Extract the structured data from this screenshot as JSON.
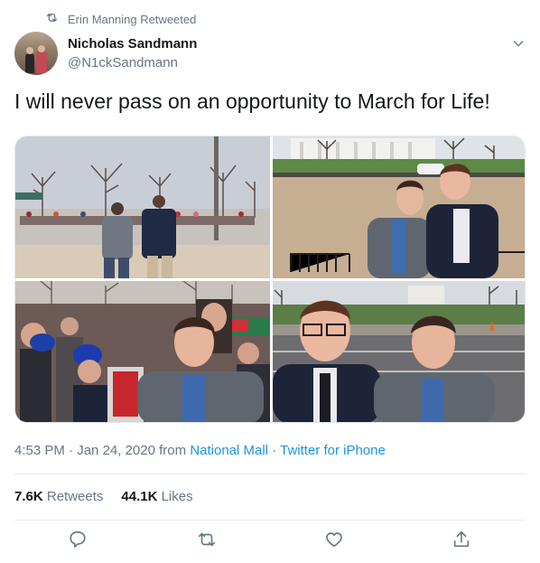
{
  "retweet_context": {
    "text": "Erin Manning Retweeted",
    "icon": "retweet-icon"
  },
  "author": {
    "display_name": "Nicholas Sandmann",
    "handle": "@N1ckSandmann"
  },
  "tweet": {
    "text": "I will never pass on an opportunity to March for Life!"
  },
  "media": {
    "count": 4,
    "photos": [
      {
        "name": "photo-crowd-walking"
      },
      {
        "name": "photo-white-house-two-men"
      },
      {
        "name": "photo-crowd-selfie"
      },
      {
        "name": "photo-mall-two-men"
      }
    ]
  },
  "meta": {
    "time": "4:53 PM",
    "separator": "·",
    "date": "Jan 24, 2020",
    "from_label": "from",
    "location": "National Mall",
    "source": "Twitter for iPhone"
  },
  "stats": {
    "retweets_count": "7.6K",
    "retweets_label": "Retweets",
    "likes_count": "44.1K",
    "likes_label": "Likes"
  },
  "actions": [
    "reply-icon",
    "retweet-icon",
    "like-icon",
    "share-icon"
  ],
  "colors": {
    "link": "#1b95e0",
    "secondary_text": "#657786",
    "primary_text": "#14171a",
    "divider": "#e6ecf0"
  }
}
